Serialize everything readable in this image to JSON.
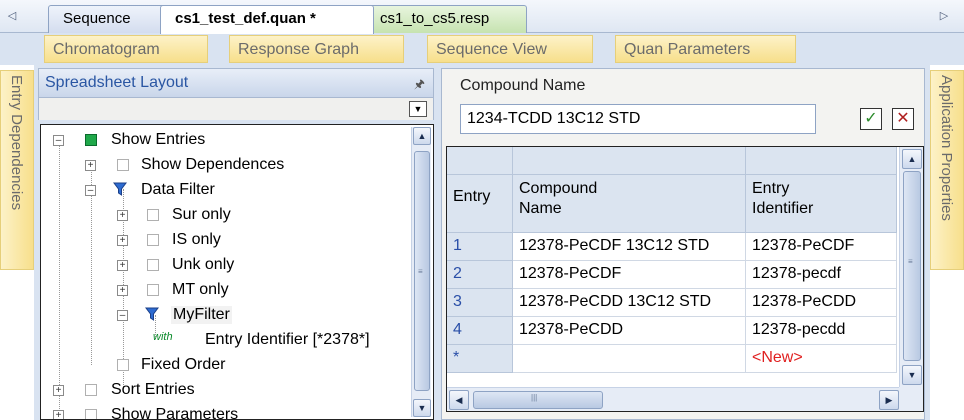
{
  "doc_tabs": {
    "items": [
      {
        "label": "Sequence"
      },
      {
        "label": "cs1_test_def.quan *"
      },
      {
        "label": "cs1_to_cs5.resp"
      }
    ],
    "nav_left": "◁",
    "nav_right": "▷"
  },
  "view_tabs": [
    {
      "label": "Chromatogram"
    },
    {
      "label": "Response Graph"
    },
    {
      "label": "Sequence View"
    },
    {
      "label": "Quan Parameters"
    }
  ],
  "side_tabs": {
    "left": "Entry Dependencies",
    "right": "Application Properties"
  },
  "spreadsheet_layout": {
    "title": "Spreadsheet Layout",
    "pin_icon": "pin-icon",
    "tree": [
      {
        "label": "Show Entries",
        "checked": true
      },
      {
        "label": "Show Dependences",
        "checked": false
      },
      {
        "label": "Data Filter",
        "icon": "funnel-icon"
      },
      {
        "label": "Sur only",
        "checked": false
      },
      {
        "label": "IS only",
        "checked": false
      },
      {
        "label": "Unk only",
        "checked": false
      },
      {
        "label": "MT only",
        "checked": false
      },
      {
        "label": "MyFilter",
        "icon": "funnel-icon",
        "selected": true
      },
      {
        "label": "Entry Identifier [*2378*]",
        "icon": "with-icon",
        "icon_text": "with"
      },
      {
        "label": "Fixed Order",
        "checked": false
      },
      {
        "label": "Sort Entries",
        "checked": false
      },
      {
        "label": "Show Parameters",
        "checked": false
      }
    ]
  },
  "compound_editor": {
    "label": "Compound Name",
    "value": "1234-TCDD 13C12 STD",
    "ok_glyph": "✓",
    "cancel_glyph": "✕"
  },
  "grid": {
    "headers": [
      "Entry",
      "Compound\nName",
      "Entry\nIdentifier"
    ],
    "rows": [
      {
        "entry": "1",
        "compound": "12378-PeCDF 13C12 STD",
        "identifier": "12378-PeCDF"
      },
      {
        "entry": "2",
        "compound": "12378-PeCDF",
        "identifier": "12378-pecdf"
      },
      {
        "entry": "3",
        "compound": "12378-PeCDD 13C12 STD",
        "identifier": "12378-PeCDD"
      },
      {
        "entry": "4",
        "compound": "12378-PeCDD",
        "identifier": "12378-pecdd"
      },
      {
        "entry": "*",
        "compound": "",
        "identifier": "<New>"
      }
    ]
  },
  "colors": {
    "accent_blue": "#2a56a3",
    "tab_yellow": "#f7df8b",
    "new_red": "#e02020",
    "checked_green": "#1fa84a"
  }
}
